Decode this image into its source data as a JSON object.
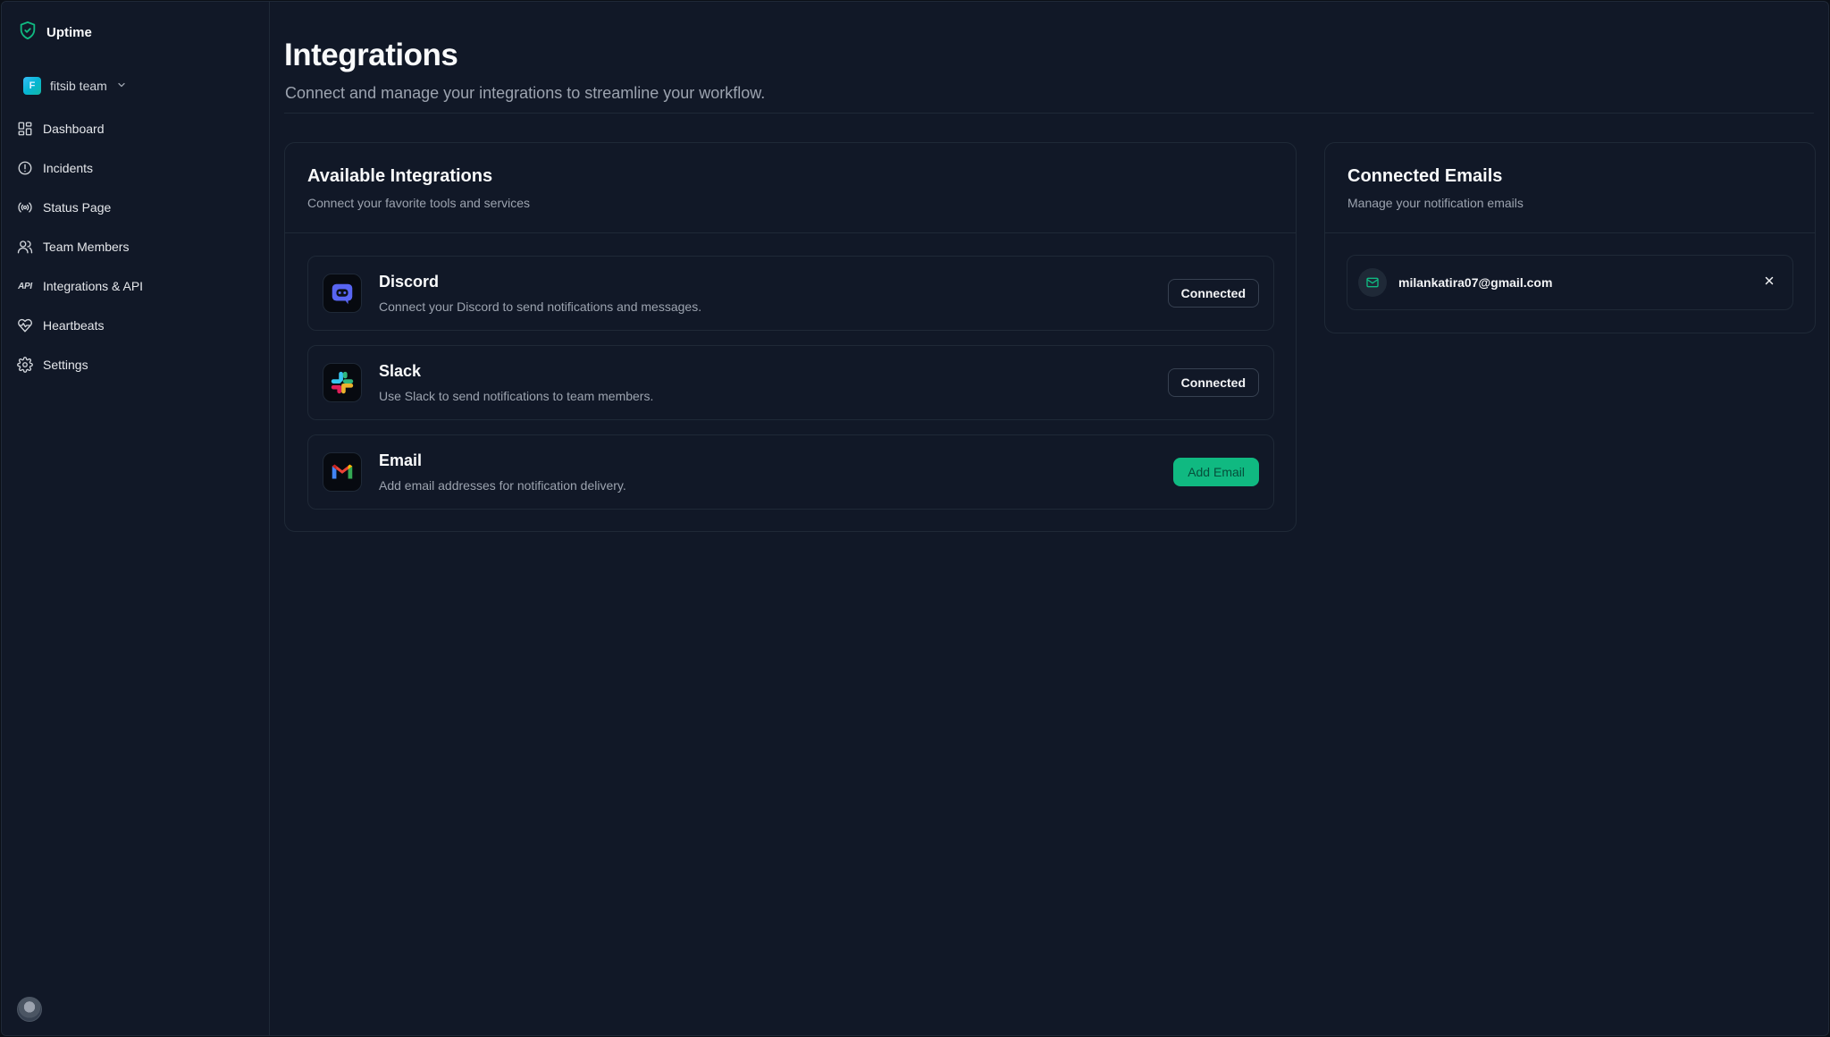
{
  "app": {
    "name": "Uptime",
    "brand_color": "#10b981"
  },
  "team": {
    "name": "fitsib team",
    "initial": "F"
  },
  "sidebar": {
    "items": [
      {
        "label": "Dashboard",
        "icon": "dashboard-grid-icon"
      },
      {
        "label": "Incidents",
        "icon": "alert-circle-icon"
      },
      {
        "label": "Status Page",
        "icon": "broadcast-icon"
      },
      {
        "label": "Team Members",
        "icon": "users-icon"
      },
      {
        "label": "Integrations & API",
        "icon": "api-icon"
      },
      {
        "label": "Heartbeats",
        "icon": "heart-pulse-icon"
      },
      {
        "label": "Settings",
        "icon": "gear-icon"
      }
    ],
    "api_glyph": "API"
  },
  "page": {
    "title": "Integrations",
    "subtitle": "Connect and manage your integrations to streamline your workflow."
  },
  "available": {
    "title": "Available Integrations",
    "description": "Connect your favorite tools and services",
    "items": [
      {
        "name": "Discord",
        "description": "Connect your Discord to send notifications and messages.",
        "action": "Connected",
        "icon": "discord-icon"
      },
      {
        "name": "Slack",
        "description": "Use Slack to send notifications to team members.",
        "action": "Connected",
        "icon": "slack-icon"
      },
      {
        "name": "Email",
        "description": "Add email addresses for notification delivery.",
        "action": "Add Email",
        "icon": "gmail-icon"
      }
    ]
  },
  "connected_emails": {
    "title": "Connected Emails",
    "description": "Manage your notification emails",
    "emails": [
      {
        "address": "milankatira07@gmail.com"
      }
    ]
  }
}
